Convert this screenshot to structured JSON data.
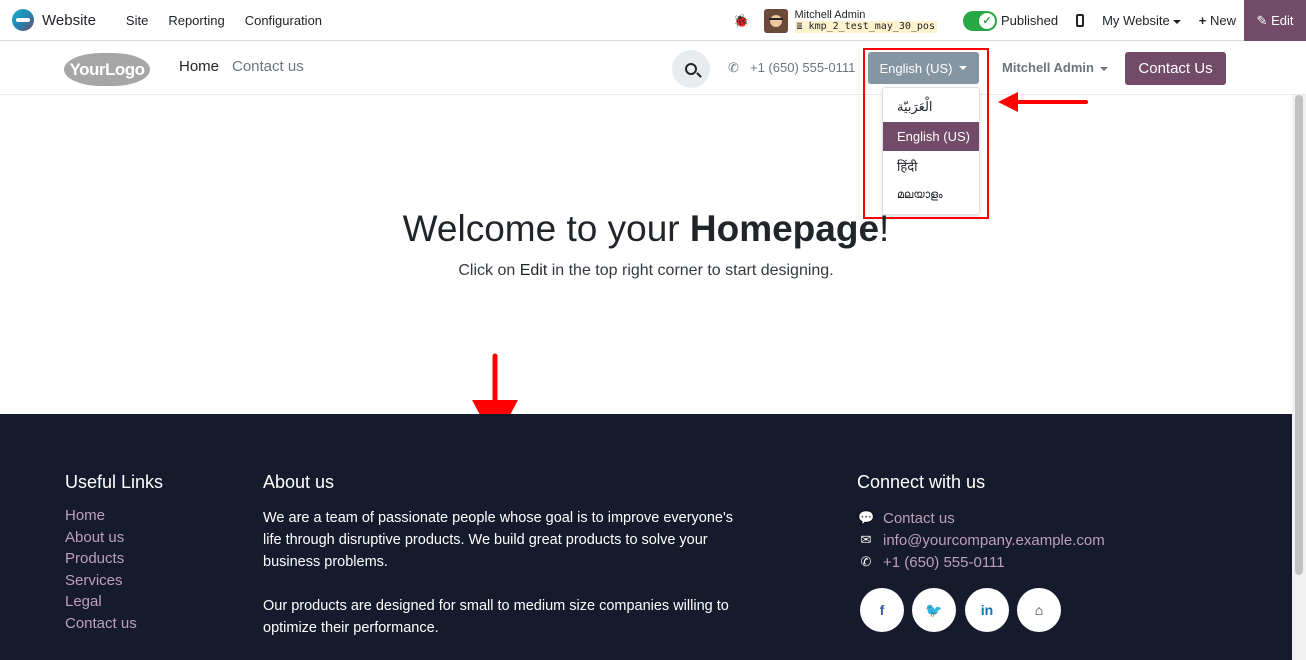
{
  "topbar": {
    "app_name": "Website",
    "menu": [
      "Site",
      "Reporting",
      "Configuration"
    ],
    "user_name": "Mitchell Admin",
    "db_name": "kmp_2_test_may_30_pos",
    "published_label": "Published",
    "my_website_label": "My Website",
    "new_label": "New",
    "edit_label": "Edit",
    "edit_color": "#714b67"
  },
  "navbar": {
    "logo_text": "YourLogo",
    "home_label": "Home",
    "contact_label": "Contact us",
    "phone": "+1 (650) 555-0111",
    "language_button": "English (US)",
    "user_menu": "Mitchell Admin",
    "contact_button": "Contact Us",
    "brand_color": "#714b67"
  },
  "language_menu": {
    "items": [
      "الْعَرَبيّة",
      "English (US)",
      "हिंदी",
      "മലയാളം"
    ],
    "active_index": 1
  },
  "hero": {
    "title_prefix": "Welcome to your ",
    "title_bold": "Homepage",
    "title_suffix": "!",
    "subtitle_prefix": "Click on ",
    "subtitle_bold": "Edit",
    "subtitle_suffix": " in the top right corner to start designing."
  },
  "footer": {
    "useful_links_title": "Useful Links",
    "useful_links": [
      "Home",
      "About us",
      "Products",
      "Services",
      "Legal",
      "Contact us"
    ],
    "about_title": "About us",
    "about_p1": "We are a team of passionate people whose goal is to improve everyone's life through disruptive products. We build great products to solve your business problems.",
    "about_p2": "Our products are designed for small to medium size companies willing to optimize their performance.",
    "connect_title": "Connect with us",
    "connect_items": [
      "Contact us",
      "info@yourcompany.example.com",
      "+1 (650) 555-0111"
    ],
    "social": [
      "f",
      "t",
      "in",
      "home"
    ]
  },
  "annotations": {
    "highlight_color": "#ff0000"
  }
}
